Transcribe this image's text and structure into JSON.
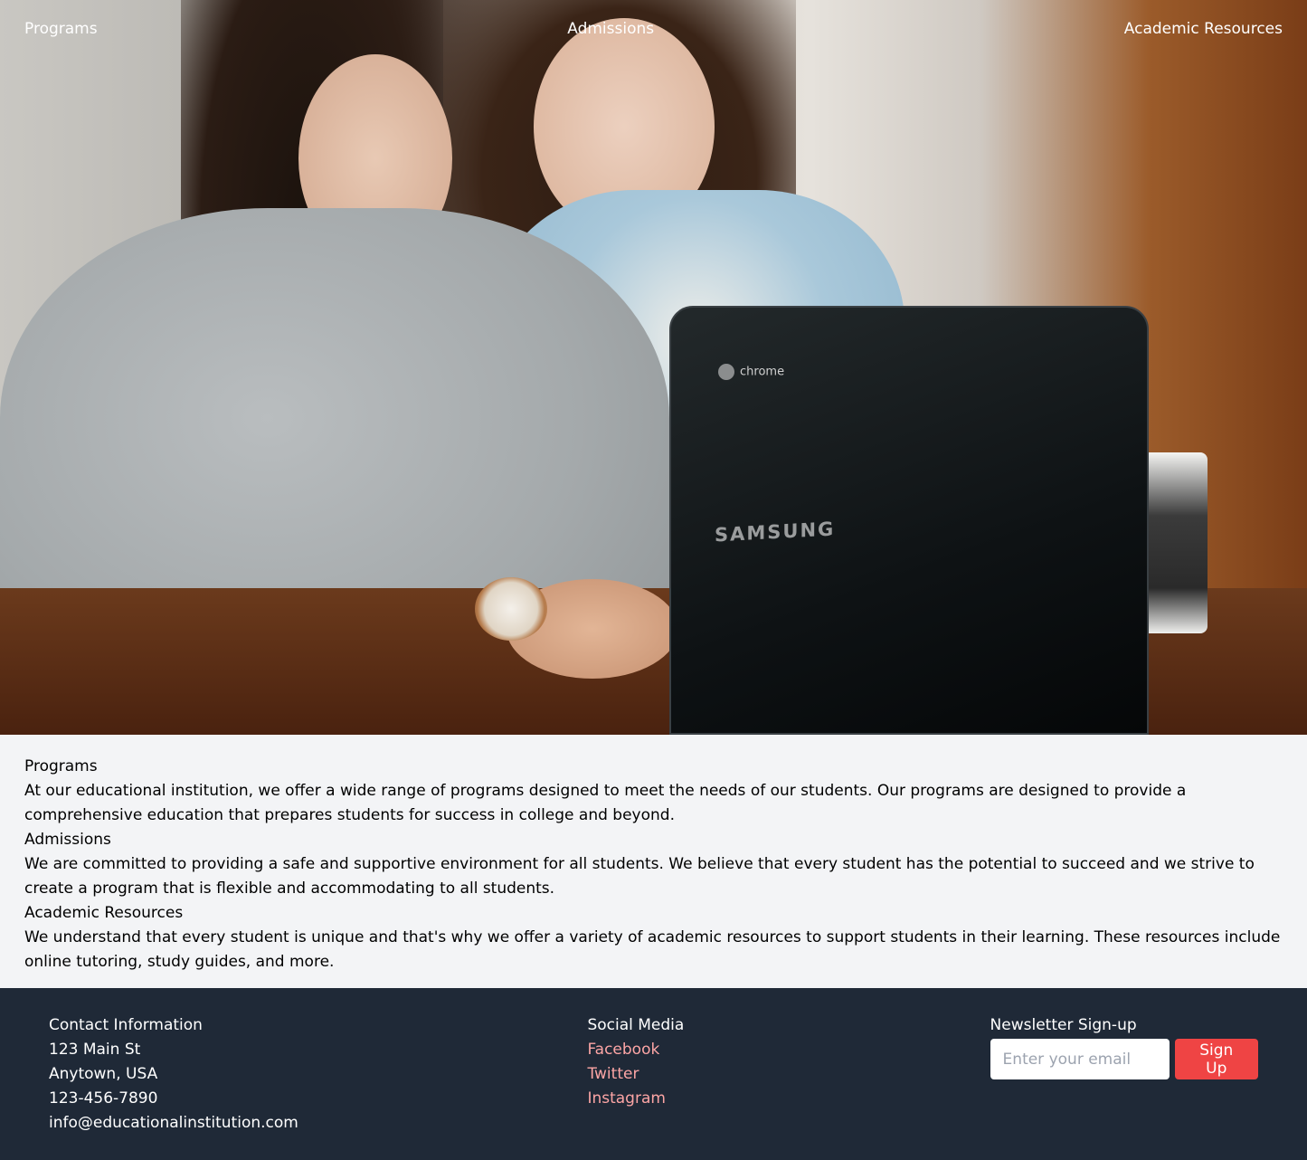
{
  "nav": {
    "items": [
      {
        "label": "Programs"
      },
      {
        "label": "Admissions"
      },
      {
        "label": "Academic Resources"
      }
    ]
  },
  "hero": {
    "image_description": "Two students working together on a laptop",
    "laptop_labels": {
      "brand": "SAMSUNG",
      "os": "chrome"
    }
  },
  "sections": [
    {
      "title": "Programs",
      "body": "At our educational institution, we offer a wide range of programs designed to meet the needs of our students. Our programs are designed to provide a comprehensive education that prepares students for success in college and beyond."
    },
    {
      "title": "Admissions",
      "body": "We are committed to providing a safe and supportive environment for all students. We believe that every student has the potential to succeed and we strive to create a program that is flexible and accommodating to all students."
    },
    {
      "title": "Academic Resources",
      "body": "We understand that every student is unique and that's why we offer a variety of academic resources to support students in their learning. These resources include online tutoring, study guides, and more."
    }
  ],
  "footer": {
    "contact": {
      "title": "Contact Information",
      "address_line1": "123 Main St",
      "address_line2": "Anytown, USA",
      "phone": "123-456-7890",
      "email": "info@educationalinstitution.com"
    },
    "social": {
      "title": "Social Media",
      "links": [
        {
          "label": "Facebook"
        },
        {
          "label": "Twitter"
        },
        {
          "label": "Instagram"
        }
      ]
    },
    "newsletter": {
      "title": "Newsletter Sign-up",
      "email_placeholder": "Enter your email",
      "email_value": "",
      "button_label": "Sign Up"
    }
  },
  "colors": {
    "content_bg": "#f3f4f6",
    "footer_bg": "#1f2937",
    "social_link": "#fca5a5",
    "button_bg": "#ef4444"
  }
}
